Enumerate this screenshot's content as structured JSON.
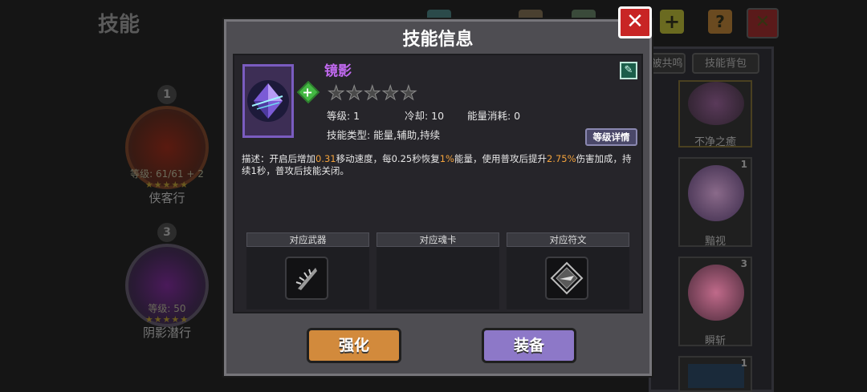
{
  "background": {
    "title": "技能",
    "slots": [
      {
        "number": "1",
        "level": "等级: 61/61 + 2",
        "stars": "★★★★★",
        "name": "侠客行"
      },
      {
        "number": "3",
        "level": "等级: 50",
        "stars": "★★★★★",
        "name": "阴影潜行"
      }
    ],
    "tabs": [
      "被共鸣",
      "技能背包"
    ],
    "cards": [
      {
        "name": "不净之癒",
        "count": ""
      },
      {
        "name": "黯视",
        "count": "1"
      },
      {
        "name": "瞬斩",
        "count": "3"
      },
      {
        "name": "",
        "count": "1"
      }
    ]
  },
  "dialog": {
    "title": "技能信息",
    "close_label": "✕",
    "skill": {
      "name": "镜影",
      "stars": "★★★★★",
      "level_label": "等级: 1",
      "cooldown_label": "冷却: 10",
      "energy_label": "能量消耗: 0",
      "type_label": "技能类型: 能量,辅助,持续"
    },
    "detail_button": "等级详情",
    "description": {
      "prefix": "描述：开启后增加",
      "value1": "0.31",
      "part2": "移动速度，每0.25秒恢复",
      "value2": "1%",
      "part3": "能量，使用普攻后提升",
      "value3": "2.75%",
      "part4": "伤害加成，持续1秒，普攻后技能关闭。"
    },
    "columns": [
      "对应武器",
      "对应魂卡",
      "对应符文"
    ],
    "enhance_button": "强化",
    "equip_button": "装备"
  },
  "colors": {
    "enhance_button": "#d28a3c",
    "equip_button": "#8d78c8",
    "close_button": "#c82525",
    "highlight": "#f2a23c",
    "skill_name": "#c169f0"
  }
}
